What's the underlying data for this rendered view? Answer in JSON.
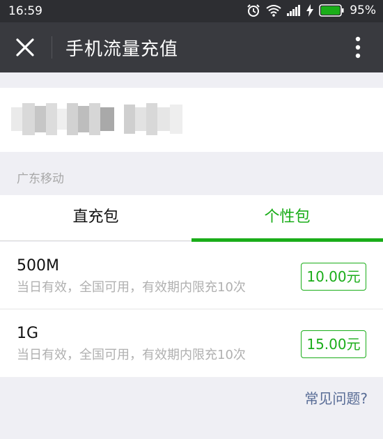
{
  "status_bar": {
    "time": "16:59",
    "battery_percent": "95%",
    "icons": [
      "alarm-icon",
      "wifi-icon",
      "signal-icon",
      "charging-icon",
      "battery-icon"
    ]
  },
  "header": {
    "title": "手机流量充值",
    "close_icon": "close-icon",
    "more_icon": "more-vertical-icon"
  },
  "carrier_label": "广东移动",
  "tabs": [
    {
      "label": "直充包",
      "selected": false
    },
    {
      "label": "个性包",
      "selected": true
    }
  ],
  "packages": [
    {
      "name": "500M",
      "description": "当日有效，全国可用，有效期内限充10次",
      "price": "10.00元"
    },
    {
      "name": "1G",
      "description": "当日有效，全国可用，有效期内限充10次",
      "price": "15.00元"
    }
  ],
  "faq_link": "常见问题?",
  "colors": {
    "accent": "#1aad19",
    "title_bar": "#393a3f",
    "status_bar": "#2d2e32",
    "link": "#576b95",
    "background": "#efeff4"
  }
}
